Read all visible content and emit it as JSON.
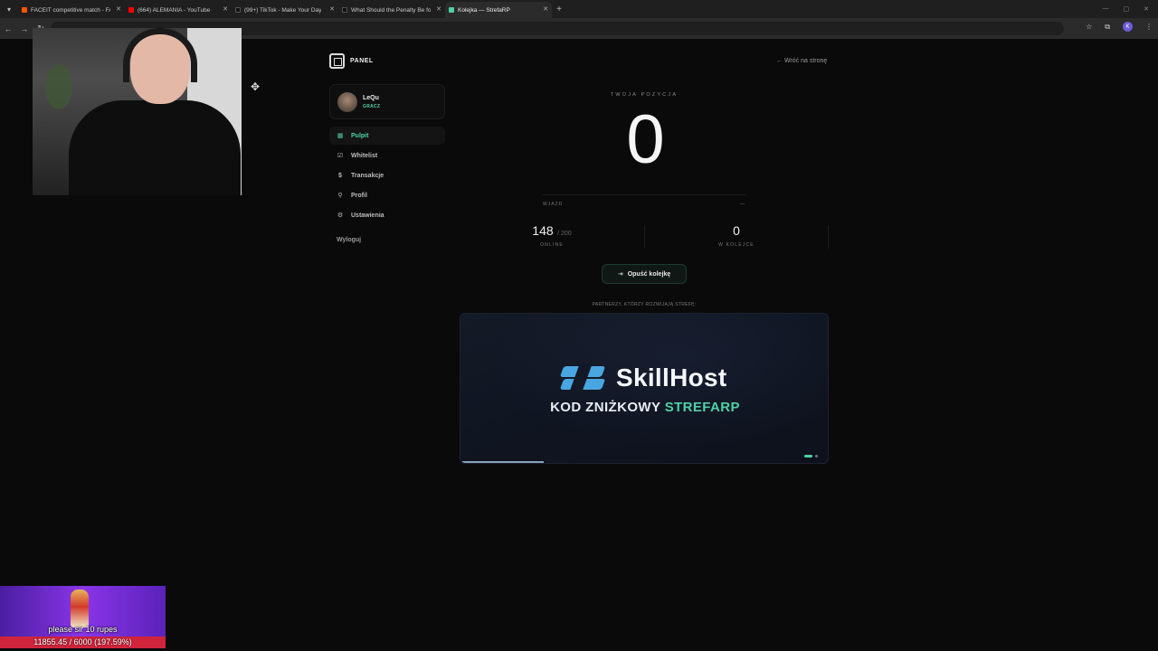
{
  "browser": {
    "tabs": [
      {
        "title": "FACEIT competitive match - FACEIT",
        "favicon_color": "#ff5500",
        "active": false
      },
      {
        "title": "(664) ALEMANIA - YouTube",
        "favicon_color": "#ff0000",
        "active": false
      },
      {
        "title": "(99+) TikTok - Make Your Day",
        "favicon_color": "#222222",
        "active": false
      },
      {
        "title": "What Should the Penalty Be for",
        "favicon_color": "#222222",
        "active": false
      },
      {
        "title": "Kolejka — StrefaRP",
        "favicon_color": "#4fd1a5",
        "active": true
      }
    ],
    "new_tab_label": "+",
    "profile_initial": "K"
  },
  "panel": {
    "brand": "PANEL",
    "back_link": "← Wróć na stronę",
    "user": {
      "name": "LeQu",
      "role": "GRACZ"
    },
    "nav": [
      {
        "label": "Pulpit",
        "icon": "dashboard-icon",
        "glyph": "▦",
        "active": true
      },
      {
        "label": "Whitelist",
        "icon": "checkbox-icon",
        "glyph": "☑",
        "active": false
      },
      {
        "label": "Transakcje",
        "icon": "dollar-icon",
        "glyph": "$",
        "active": false
      },
      {
        "label": "Profil",
        "icon": "user-icon",
        "glyph": "⚲",
        "active": false
      },
      {
        "label": "Ustawienia",
        "icon": "sliders-icon",
        "glyph": "⚙",
        "active": false
      }
    ],
    "logout": "Wyloguj"
  },
  "queue": {
    "position_label": "TWOJA POZYCJA",
    "position_value": "0",
    "wjazd_label": "WJAZD",
    "wjazd_value": "—",
    "online_value": "148",
    "online_max": "/ 200",
    "online_label": "ONLINE",
    "queue_value": "0",
    "queue_label": "W KOLEJCE",
    "leave_button": "Opuść kolejkę"
  },
  "partners": {
    "label": "PARTNERZY, KTÓRZY ROZWIJAJĄ STREFĘ:",
    "banner_brand": "SkillHost",
    "banner_code_prefix": "KOD ZNIŻKOWY",
    "banner_code": "STREFARP",
    "accent": "#4fd1a5"
  },
  "stream_goal": {
    "title": "please sir 10 rupes",
    "progress_text": "11855.45 / 6000 (197.59%)"
  }
}
